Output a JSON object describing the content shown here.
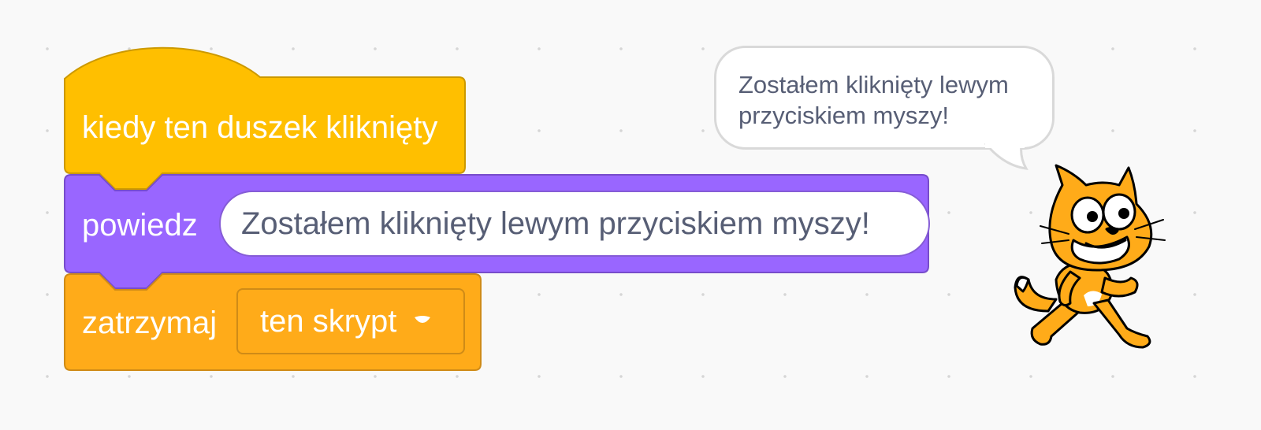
{
  "script": {
    "hat_block": {
      "label": "kiedy ten duszek kliknięty",
      "category": "events",
      "color": "#ffbf00",
      "border": "#cc9900"
    },
    "say_block": {
      "label": "powiedz",
      "input_value": "Zostałem kliknięty lewym przyciskiem myszy!",
      "category": "looks",
      "color": "#9966ff",
      "border": "#774dcb"
    },
    "stop_block": {
      "label": "zatrzymaj",
      "dropdown_value": "ten skrypt",
      "dropdown_icon": "caret-down-icon",
      "category": "control",
      "color": "#ffab19",
      "border": "#cf8b17"
    }
  },
  "stage": {
    "speech_bubble": {
      "text_line1": "Zostałem kliknięty lewym",
      "text_line2": "przyciskiem myszy!"
    },
    "sprite": {
      "icon": "scratch-cat-sprite",
      "color": "#ffab19"
    }
  },
  "colors": {
    "workspace_bg": "#f9f9f9",
    "grid_dot": "#d6d6d6",
    "input_text": "#575e75"
  }
}
